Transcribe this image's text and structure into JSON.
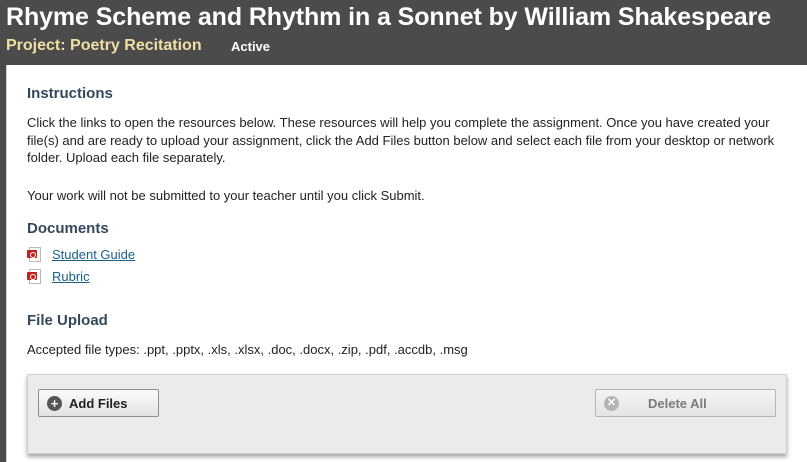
{
  "header": {
    "title": "Rhyme Scheme and Rhythm in a Sonnet by William Shakespeare",
    "project": "Project: Poetry Recitation",
    "status": "Active"
  },
  "instructions": {
    "heading": "Instructions",
    "paragraph1": "Click the links to open the resources below. These resources will help you complete the assignment. Once you have created your file(s) and are ready to upload your assignment, click the Add Files button below and select each file from your desktop or network folder. Upload each file separately.",
    "paragraph2": "Your work will not be submitted to your teacher until you click Submit."
  },
  "documents": {
    "heading": "Documents",
    "items": [
      {
        "label": "Student Guide",
        "icon": "pdf-icon"
      },
      {
        "label": "Rubric",
        "icon": "pdf-icon"
      }
    ]
  },
  "file_upload": {
    "heading": "File Upload",
    "accepted_types": "Accepted file types: .ppt, .pptx, .xls, .xlsx, .doc, .docx, .zip, .pdf, .accdb, .msg",
    "add_files_label": "Add Files",
    "delete_all_label": "Delete All"
  },
  "colors": {
    "header_bg": "#4b4b4b",
    "project_text": "#f0dfa4",
    "section_heading": "#34495e",
    "link": "#1a5f8a",
    "pdf_red": "#c41f1f"
  }
}
